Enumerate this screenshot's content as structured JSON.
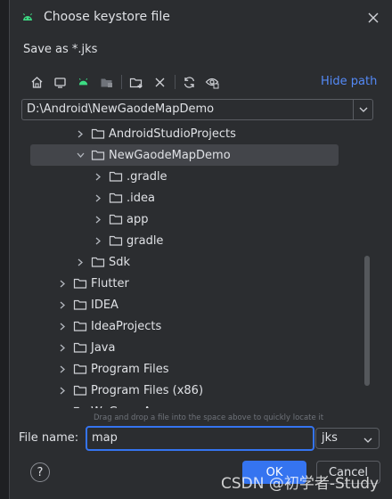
{
  "dialog": {
    "title": "Choose keystore file",
    "subtitle": "Save as *.jks"
  },
  "toolbar": {
    "hide_path_label": "Hide path",
    "icons": [
      "home-icon",
      "desktop-icon",
      "android-project-icon",
      "module-icon",
      "new-folder-icon",
      "delete-icon",
      "refresh-icon",
      "show-hidden-icon"
    ]
  },
  "path": {
    "value": "D:\\Android\\NewGaodeMapDemo"
  },
  "tree": {
    "items": [
      {
        "label": "AndroidStudioProjects",
        "expanded": false
      },
      {
        "label": "NewGaodeMapDemo",
        "expanded": true
      },
      {
        "label": ".gradle",
        "expanded": false
      },
      {
        "label": ".idea",
        "expanded": false
      },
      {
        "label": "app",
        "expanded": false
      },
      {
        "label": "gradle",
        "expanded": false
      },
      {
        "label": "Sdk",
        "expanded": false
      },
      {
        "label": "Flutter",
        "expanded": false
      },
      {
        "label": "IDEA",
        "expanded": false
      },
      {
        "label": "IdeaProjects",
        "expanded": false
      },
      {
        "label": "Java",
        "expanded": false
      },
      {
        "label": "Program Files",
        "expanded": false
      },
      {
        "label": "Program Files (x86)",
        "expanded": false
      },
      {
        "label": "WeGameApps",
        "expanded": false
      }
    ]
  },
  "drag_hint": "Drag and drop a file into the space above to quickly locate it",
  "file_name": {
    "label": "File name:",
    "value": "map",
    "extension": "jks"
  },
  "buttons": {
    "help": "?",
    "ok": "OK",
    "cancel": "Cancel"
  },
  "watermark": "CSDN @初学者-Study",
  "colors": {
    "accent": "#3574f0",
    "link": "#548af7",
    "background": "#2b2d30",
    "selection": "#43454a"
  }
}
